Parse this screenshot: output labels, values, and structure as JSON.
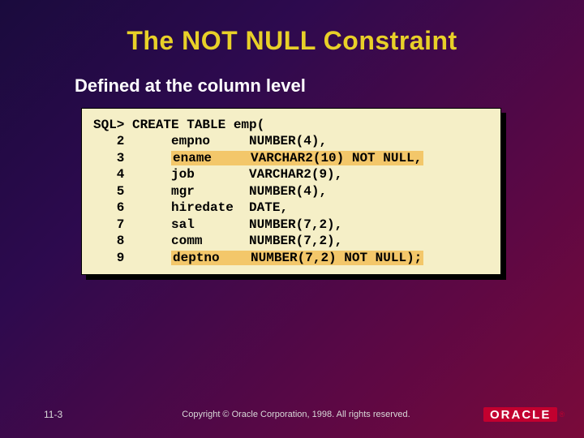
{
  "title": "The NOT NULL Constraint",
  "subtitle": "Defined at the column level",
  "code": {
    "l1a": "SQL> CREATE TABLE emp(",
    "l2a": "   2      empno     NUMBER(4),",
    "l3a": "   3      ",
    "l3h": "ename     VARCHAR2(10) NOT NULL,",
    "l4a": "   4      job       VARCHAR2(9),",
    "l5a": "   5      mgr       NUMBER(4),",
    "l6a": "   6      hiredate  DATE,",
    "l7a": "   7      sal       NUMBER(7,2),",
    "l8a": "   8      comm      NUMBER(7,2),",
    "l9a": "   9      ",
    "l9h": "deptno    NUMBER(7,2) NOT NULL);"
  },
  "footer": {
    "slide_number": "11-3",
    "copyright": "Copyright © Oracle Corporation, 1998. All rights reserved.",
    "logo_text": "ORACLE",
    "logo_reg": "®"
  }
}
